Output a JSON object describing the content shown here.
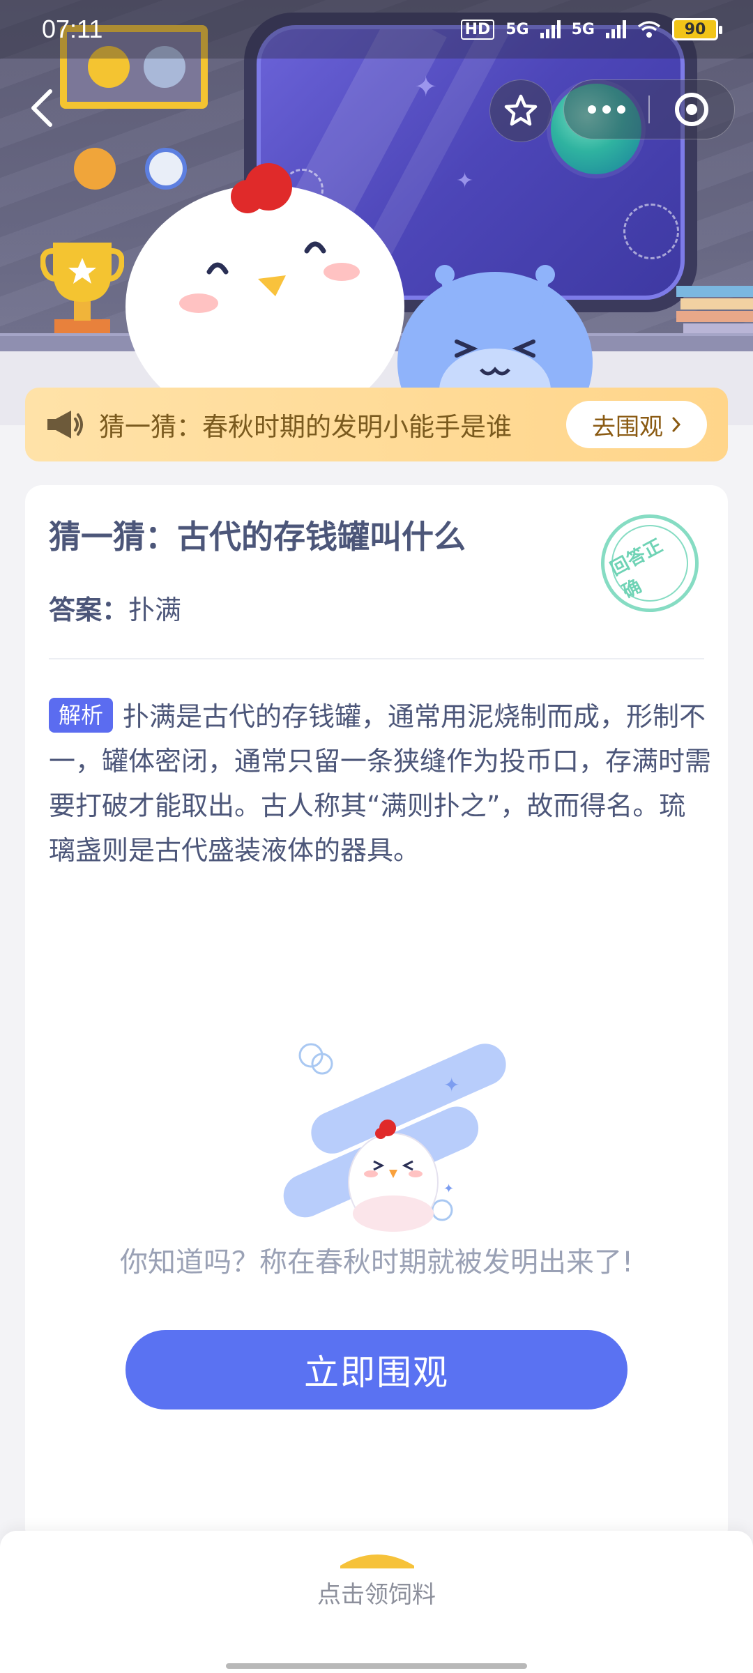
{
  "status_bar": {
    "time": "07:11",
    "network_1": "5G",
    "network_2": "5G",
    "hd_badge": "HD",
    "battery": "90"
  },
  "nav": {
    "back_icon": "chevron-left-icon",
    "favorite_icon": "star-outline-icon",
    "more_icon": "more-dots-icon",
    "close_icon": "target-close-icon"
  },
  "banner": {
    "text": "猜一猜：春秋时期的发明小能手是谁",
    "button_label": "去围观",
    "icon": "megaphone-icon"
  },
  "card": {
    "question": "猜一猜：古代的存钱罐叫什么",
    "answer_label": "答案：",
    "answer_value": "扑满",
    "stamp_text": "回答正确",
    "analysis_tag": "解析",
    "analysis_text": "扑满是古代的存钱罐，通常用泥烧制而成，形制不一，罐体密闭，通常只留一条狭缝作为投币口，存满时需要打破才能取出。古人称其“满则扑之”，故而得名。琉璃盏则是古代盛装液体的器具。",
    "tip": "你知道吗？称在春秋时期就被发明出来了!",
    "cta_label": "立即围观"
  },
  "drawer": {
    "label": "点击领饲料"
  },
  "colors": {
    "accent": "#5a72f2",
    "tag": "#5b6cf0",
    "banner_bg": "#ffd58a",
    "stamp": "#86dcc3"
  }
}
